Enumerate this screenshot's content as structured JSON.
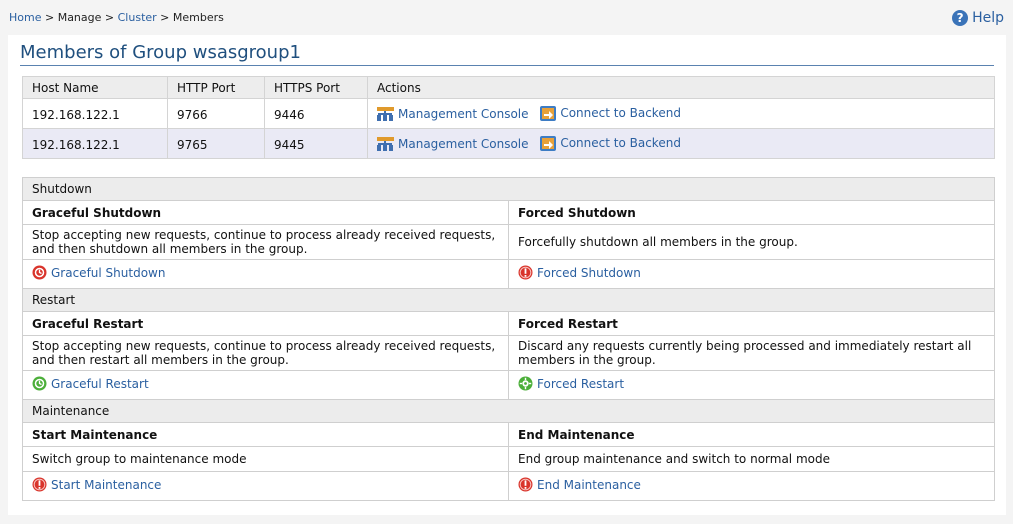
{
  "breadcrumb": {
    "home": "Home",
    "sep1": ">",
    "manage": "Manage",
    "sep2": ">",
    "cluster": "Cluster",
    "sep3": ">",
    "members": "Members"
  },
  "help": {
    "icon": "help-icon",
    "label": "Help"
  },
  "page": {
    "title": "Members of Group wsasgroup1"
  },
  "members_table": {
    "headers": [
      "Host Name",
      "HTTP Port",
      "HTTPS Port",
      "Actions"
    ],
    "rows": [
      {
        "host": "192.168.122.1",
        "http": "9766",
        "https": "9446",
        "console": "Management Console",
        "backend": "Connect to Backend"
      },
      {
        "host": "192.168.122.1",
        "http": "9765",
        "https": "9445",
        "console": "Management Console",
        "backend": "Connect to Backend"
      }
    ]
  },
  "operations": {
    "shutdown": {
      "section": "Shutdown",
      "graceful": {
        "title": "Graceful Shutdown",
        "description": "Stop accepting new requests, continue to process already received requests, and then shutdown all members in the group.",
        "link": "Graceful Shutdown"
      },
      "forced": {
        "title": "Forced Shutdown",
        "description": "Forcefully shutdown all members in the group.",
        "link": "Forced Shutdown"
      }
    },
    "restart": {
      "section": "Restart",
      "graceful": {
        "title": "Graceful Restart",
        "description": "Stop accepting new requests, continue to process already received requests, and then restart all members in the group.",
        "link": "Graceful Restart"
      },
      "forced": {
        "title": "Forced Restart",
        "description": "Discard any requests currently being processed and immediately restart all members in the group.",
        "link": "Forced Restart"
      }
    },
    "maintenance": {
      "section": "Maintenance",
      "start": {
        "title": "Start Maintenance",
        "description": "Switch group to maintenance mode",
        "link": "Start Maintenance"
      },
      "end": {
        "title": "End Maintenance",
        "description": "End group maintenance and switch to normal mode",
        "link": "End Maintenance"
      }
    }
  },
  "colors": {
    "link": "#2a5fa0",
    "title": "#1f4f7e",
    "danger": "#d9342b",
    "success": "#4caf3a"
  }
}
